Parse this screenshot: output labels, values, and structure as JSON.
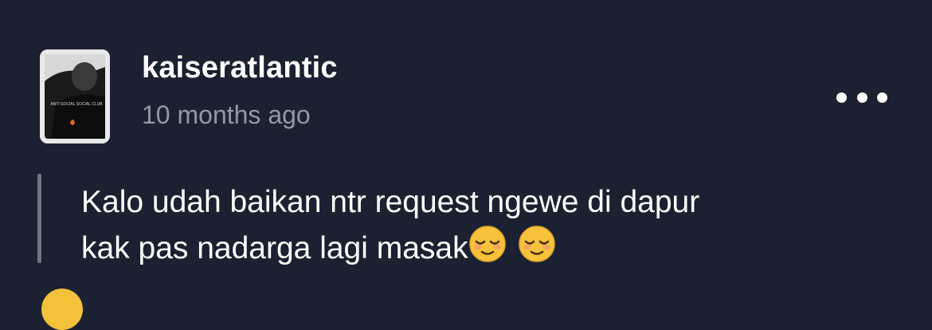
{
  "post": {
    "author": {
      "username": "kaiseratlantic",
      "avatar_shirt_text": "ANTI SOCIAL SOCIAL CLUB"
    },
    "timestamp": "10 months ago",
    "menu_icon": "more-horizontal-icon",
    "quote": {
      "line1": "Kalo udah baikan ntr request ngewe di dapur",
      "line2": "kak pas nadarga lagi masak",
      "emojis": [
        "relieved-face-emoji",
        "relieved-face-emoji"
      ]
    },
    "reaction_icon": "emoji-reaction-icon"
  },
  "colors": {
    "background": "#1b2130",
    "text_primary": "#ffffff",
    "text_secondary": "#9298a6",
    "quote_bar": "#6f7686"
  }
}
